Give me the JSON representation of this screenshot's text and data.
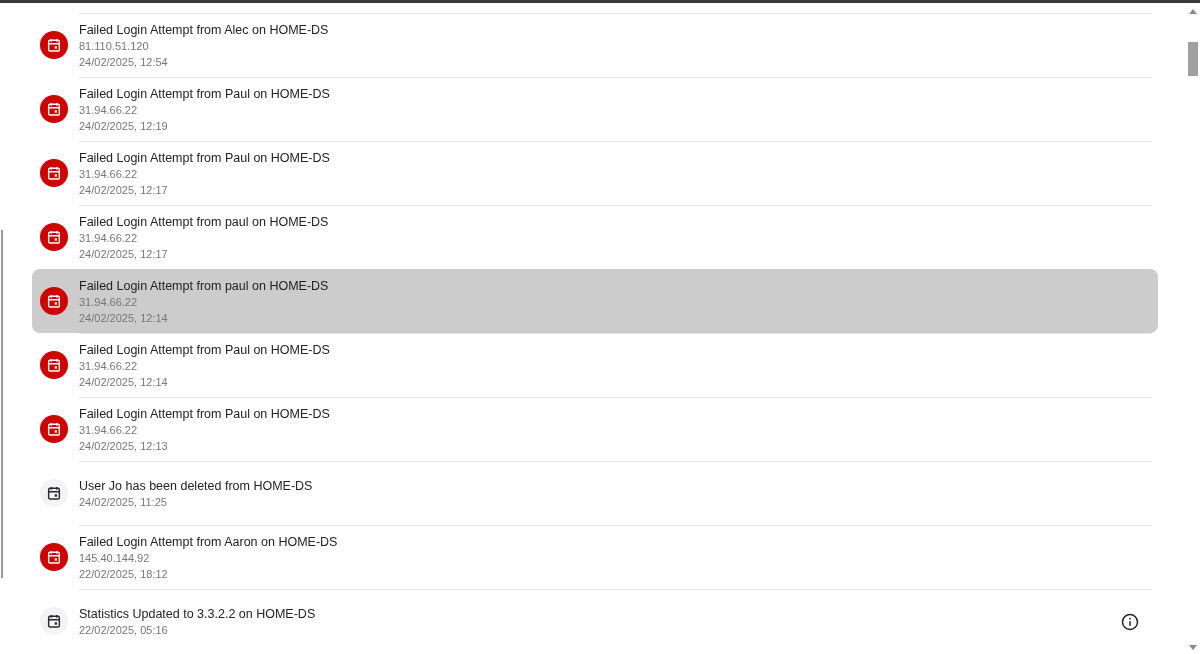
{
  "events": [
    {
      "kind": "alert",
      "title": "Failed Login Attempt from Alec on HOME-DS",
      "detail": "81.110.51.120",
      "time": "24/02/2025, 12:54",
      "selected": false
    },
    {
      "kind": "alert",
      "title": "Failed Login Attempt from Paul on HOME-DS",
      "detail": "31.94.66.22",
      "time": "24/02/2025, 12:19",
      "selected": false
    },
    {
      "kind": "alert",
      "title": "Failed Login Attempt from Paul on HOME-DS",
      "detail": "31.94.66.22",
      "time": "24/02/2025, 12:17",
      "selected": false
    },
    {
      "kind": "alert",
      "title": "Failed Login Attempt from paul on HOME-DS",
      "detail": "31.94.66.22",
      "time": "24/02/2025, 12:17",
      "selected": false
    },
    {
      "kind": "alert",
      "title": "Failed Login Attempt from paul on HOME-DS",
      "detail": "31.94.66.22",
      "time": "24/02/2025, 12:14",
      "selected": true
    },
    {
      "kind": "alert",
      "title": "Failed Login Attempt from Paul on HOME-DS",
      "detail": "31.94.66.22",
      "time": "24/02/2025, 12:14",
      "selected": false
    },
    {
      "kind": "alert",
      "title": "Failed Login Attempt from Paul on HOME-DS",
      "detail": "31.94.66.22",
      "time": "24/02/2025, 12:13",
      "selected": false
    },
    {
      "kind": "info",
      "title": "User Jo has been deleted from HOME-DS",
      "time": "24/02/2025, 11:25",
      "selected": false
    },
    {
      "kind": "alert",
      "title": "Failed Login Attempt from Aaron on HOME-DS",
      "detail": "145.40.144.92",
      "time": "22/02/2025, 18:12",
      "selected": false
    },
    {
      "kind": "info",
      "title": "Statistics Updated to 3.3.2.2 on HOME-DS",
      "time": "22/02/2025, 05:16",
      "selected": false,
      "has_details": true
    }
  ]
}
